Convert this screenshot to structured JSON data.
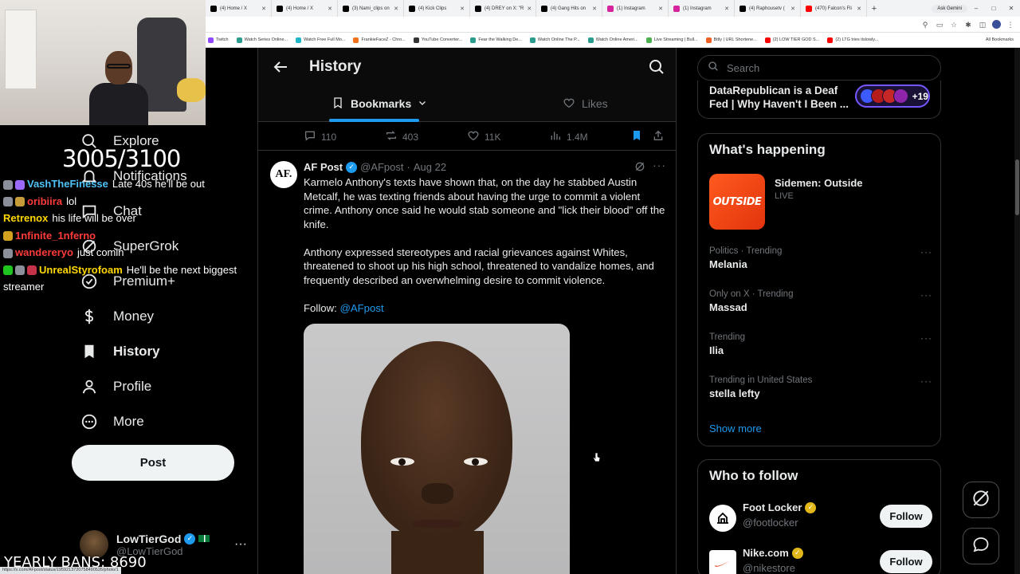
{
  "browser": {
    "tabs": [
      {
        "title": "(4) Home / X",
        "icon": "x-icon",
        "color": "#000000"
      },
      {
        "title": "(4) Home / X",
        "icon": "x-icon",
        "color": "#000000"
      },
      {
        "title": "(3) Nami_clips on",
        "icon": "x-icon",
        "color": "#000000"
      },
      {
        "title": "(4) Kick Clips",
        "icon": "x-icon",
        "color": "#000000"
      },
      {
        "title": "(4) DREY on X: \"R",
        "icon": "x-icon",
        "color": "#000000"
      },
      {
        "title": "(4) Gang Hits on",
        "icon": "x-icon",
        "color": "#000000"
      },
      {
        "title": "(1) Instagram",
        "icon": "instagram-icon",
        "color": "#d6249f"
      },
      {
        "title": "(1) Instagram",
        "icon": "instagram-icon",
        "color": "#d6249f"
      },
      {
        "title": "(4) Raphousetv (",
        "icon": "x-icon",
        "color": "#000000"
      },
      {
        "title": "(470) Falcon's Fli",
        "icon": "youtube-icon",
        "color": "#ff0000"
      }
    ],
    "new_tab_label": "+",
    "ask_gemini": "Ask Gemini",
    "bookmarks": [
      {
        "label": "Twitch",
        "color": "#9146ff"
      },
      {
        "label": "Watch Series Online...",
        "color": "#2a9d8f"
      },
      {
        "label": "Watch Free Full Mo...",
        "color": "#1fb6c9"
      },
      {
        "label": "FrankieFaceZ - Chro...",
        "color": "#f2711c"
      },
      {
        "label": "YouTube Converter...",
        "color": "#333333"
      },
      {
        "label": "Fear the Walking De...",
        "color": "#2a9d8f"
      },
      {
        "label": "Watch Online The P...",
        "color": "#2a9d8f"
      },
      {
        "label": "Watch Online Ameri...",
        "color": "#2a9d8f"
      },
      {
        "label": "Live Streaming | Bull...",
        "color": "#4caf50"
      },
      {
        "label": "Bitly | URL Shortene...",
        "color": "#ee6123"
      },
      {
        "label": "(2) LOW TIER GOD S...",
        "color": "#ff0000"
      },
      {
        "label": "(2) LTG tries itslowly...",
        "color": "#ff0000"
      }
    ],
    "all_bookmarks": "All Bookmarks",
    "status_url": "https://x.com/AFpost/status/1959213720758490526/photo/1"
  },
  "overlay": {
    "sub_counter": "3005/3100",
    "ban_counter": "YEARLY BANS: 8690",
    "chat": [
      {
        "user": "VashTheFinesse",
        "user_color": "#4fc3f7",
        "message": "Late 40s he'll be out",
        "badges": [
          "#8a8f99",
          "#9b6bff"
        ]
      },
      {
        "user": "oribiira",
        "user_color": "#ff3b3b",
        "message": "lol",
        "badges": [
          "#8a8f99",
          "#c79a3a"
        ]
      },
      {
        "user": "Retrenox",
        "user_color": "#ffd700",
        "message": "his life will be over",
        "badges": []
      },
      {
        "user": "1nfinite_1nferno",
        "user_color": "#ff3b3b",
        "message": "",
        "badges": [
          "#d4a020"
        ]
      },
      {
        "user": "wandereryo",
        "user_color": "#ff3b3b",
        "message": "just comin",
        "badges": [
          "#8a8f99"
        ]
      },
      {
        "user": "UnrealStyrofoam",
        "user_color": "#ffd700",
        "message": "He'll be the next biggest streamer",
        "badges": [
          "#1fc41f",
          "#8a8f99",
          "#c7324b"
        ]
      }
    ]
  },
  "nav": {
    "items": [
      {
        "label": "Explore",
        "icon": "search-icon",
        "active": false
      },
      {
        "label": "Notifications",
        "icon": "bell-icon",
        "active": false
      },
      {
        "label": "Chat",
        "icon": "chat-icon",
        "active": false
      },
      {
        "label": "SuperGrok",
        "icon": "grok-icon",
        "active": false
      },
      {
        "label": "Premium+",
        "icon": "premium-icon",
        "active": false
      },
      {
        "label": "Money",
        "icon": "money-icon",
        "active": false
      },
      {
        "label": "History",
        "icon": "bookmark-icon",
        "active": true
      },
      {
        "label": "Profile",
        "icon": "person-icon",
        "active": false
      },
      {
        "label": "More",
        "icon": "more-circle-icon",
        "active": false
      }
    ],
    "post_label": "Post",
    "profile": {
      "name": "LowTierGod",
      "handle": "@LowTierGod",
      "more": "···"
    }
  },
  "main": {
    "title": "History",
    "tabs": [
      {
        "label": "Bookmarks",
        "icon": "bookmark-icon",
        "active": true
      },
      {
        "label": "Likes",
        "icon": "heart-icon",
        "active": false
      }
    ],
    "prev_actions": {
      "replies": "110",
      "reposts": "403",
      "likes": "11K",
      "views": "1.4M"
    },
    "tweet": {
      "avatar_text": "AF.",
      "name": "AF Post",
      "handle": "@AFpost",
      "dot": "·",
      "date": "Aug 22",
      "more": "···",
      "paragraphs": [
        "Karmelo Anthony's texts have shown that, on the day he stabbed Austin Metcalf, he was texting friends about having the urge to commit a violent crime. Anthony once said he would stab someone and \"lick their blood\" off the knife.",
        "Anthony expressed stereotypes and racial grievances against Whites, threatened to shoot up his high school, threatened to vandalize homes, and frequently described an overwhelming desire to commit violence."
      ],
      "follow_prefix": "Follow: ",
      "follow_link": "@AFpost"
    }
  },
  "right": {
    "search_placeholder": "Search",
    "live_card": {
      "title": "DataRepublican is a Deaf Fed | Why Haven't I Been ...",
      "count": "+19"
    },
    "happening": {
      "title": "What's happening",
      "feature": {
        "thumb_text": "OUTSIDE",
        "title": "Sidemen: Outside",
        "subtitle": "LIVE"
      },
      "trends": [
        {
          "meta": "Politics · Trending",
          "name": "Melania",
          "more": "···"
        },
        {
          "meta": "Only on X · Trending",
          "name": "Massad",
          "more": "···"
        },
        {
          "meta": "Trending",
          "name": "Ilia",
          "more": "···"
        },
        {
          "meta": "Trending in United States",
          "name": "stella lefty",
          "more": "···"
        }
      ],
      "show_more": "Show more"
    },
    "who_to_follow": {
      "title": "Who to follow",
      "accounts": [
        {
          "name": "Foot Locker",
          "handle": "@footlocker",
          "button": "Follow"
        },
        {
          "name": "Nike.com",
          "handle": "@nikestore",
          "button": "Follow"
        }
      ]
    }
  },
  "colors": {
    "accent": "#1d9bf0",
    "background": "#000000",
    "border": "#2f3336",
    "muted": "#71767b",
    "live_pill": "#7856ff"
  }
}
